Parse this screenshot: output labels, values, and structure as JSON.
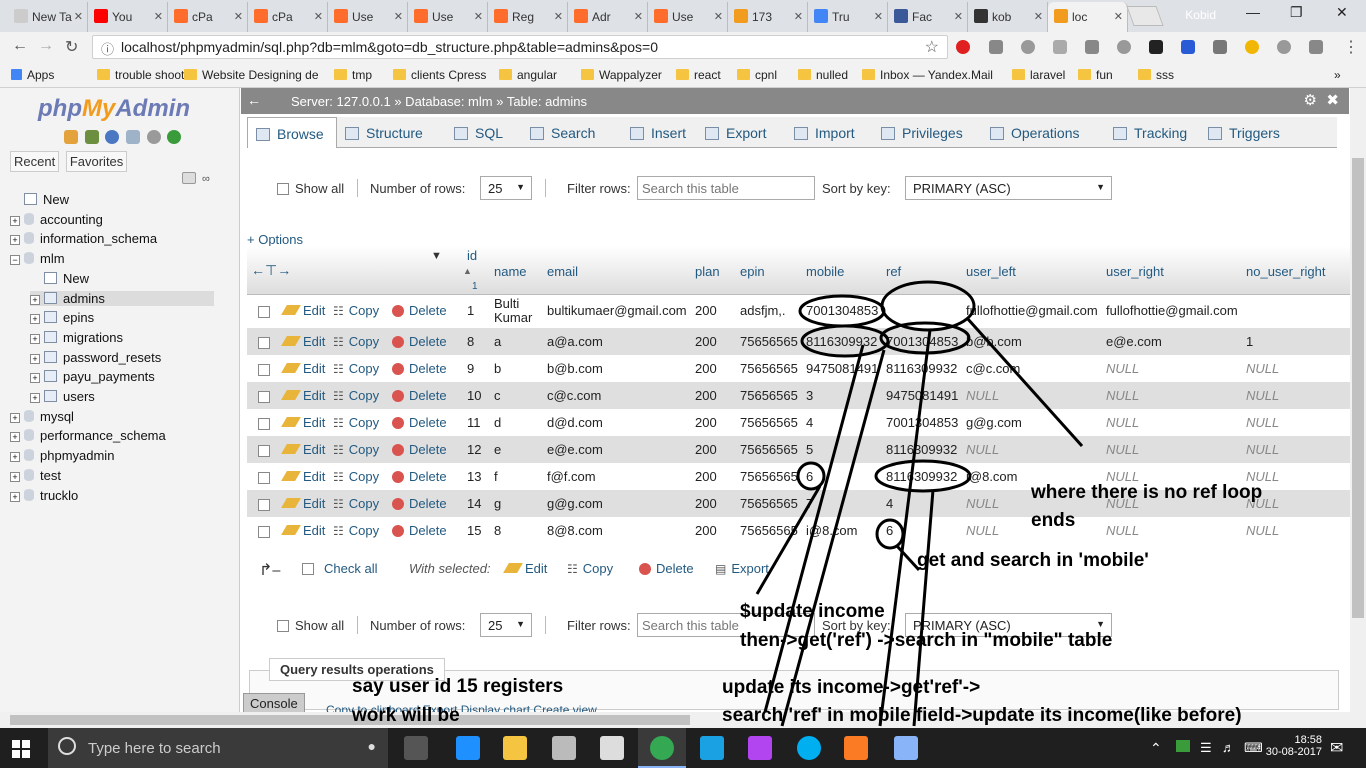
{
  "browser": {
    "tabs": [
      {
        "label": "New Ta",
        "color": "#cccccc"
      },
      {
        "label": "You",
        "color": "#ff0000"
      },
      {
        "label": "cPa",
        "color": "#ff6c2c"
      },
      {
        "label": "cPa",
        "color": "#ff6c2c"
      },
      {
        "label": "Use",
        "color": "#ff6c2c"
      },
      {
        "label": "Use",
        "color": "#ff6c2c"
      },
      {
        "label": "Reg",
        "color": "#ff6c2c"
      },
      {
        "label": "Adr",
        "color": "#ff6c2c"
      },
      {
        "label": "Use",
        "color": "#ff6c2c"
      },
      {
        "label": "173",
        "color": "#f29c1f"
      },
      {
        "label": "Tru",
        "color": "#4285f4"
      },
      {
        "label": "Fac",
        "color": "#3b5998"
      },
      {
        "label": "kob",
        "color": "#333333"
      },
      {
        "label": "loc",
        "color": "#f29c1f"
      }
    ],
    "profile": "Kobid",
    "url": "localhost/phpmyadmin/sql.php?db=mlm&goto=db_structure.php&table=admins&pos=0",
    "bookmarks": [
      "Apps",
      "trouble shoot",
      "Website Designing de",
      "tmp",
      "clients Cpress",
      "angular",
      "Wappalyzer",
      "react",
      "cpnl",
      "nulled",
      "Inbox — Yandex.Mail",
      "laravel",
      "fun",
      "sss"
    ]
  },
  "nav": {
    "logo_php": "php",
    "logo_my": "My",
    "logo_admin": "Admin",
    "tab_recent": "Recent",
    "tab_favorites": "Favorites",
    "tree": [
      {
        "label": "New",
        "kind": "new",
        "indent": 0
      },
      {
        "label": "accounting",
        "kind": "db",
        "indent": 0
      },
      {
        "label": "information_schema",
        "kind": "db",
        "indent": 0
      },
      {
        "label": "mlm",
        "kind": "db-open",
        "indent": 0
      },
      {
        "label": "New",
        "kind": "new",
        "indent": 1
      },
      {
        "label": "admins",
        "kind": "table",
        "indent": 1,
        "selected": true
      },
      {
        "label": "epins",
        "kind": "table",
        "indent": 1
      },
      {
        "label": "migrations",
        "kind": "table",
        "indent": 1
      },
      {
        "label": "password_resets",
        "kind": "table",
        "indent": 1
      },
      {
        "label": "payu_payments",
        "kind": "table",
        "indent": 1
      },
      {
        "label": "users",
        "kind": "table",
        "indent": 1
      },
      {
        "label": "mysql",
        "kind": "db",
        "indent": 0
      },
      {
        "label": "performance_schema",
        "kind": "db",
        "indent": 0
      },
      {
        "label": "phpmyadmin",
        "kind": "db",
        "indent": 0
      },
      {
        "label": "test",
        "kind": "db",
        "indent": 0
      },
      {
        "label": "trucklo",
        "kind": "db",
        "indent": 0
      }
    ]
  },
  "main": {
    "breadcrumb": "Server: 127.0.0.1 » Database: mlm » Table: admins",
    "tabs": [
      "Browse",
      "Structure",
      "SQL",
      "Search",
      "Insert",
      "Export",
      "Import",
      "Privileges",
      "Operations",
      "Tracking",
      "Triggers"
    ],
    "show_all": "Show all",
    "num_rows_label": "Number of rows:",
    "num_rows_value": "25",
    "filter_label": "Filter rows:",
    "filter_placeholder": "Search this table",
    "sort_label": "Sort by key:",
    "sort_value": "PRIMARY (ASC)",
    "options": "+ Options",
    "columns": [
      "id",
      "name",
      "email",
      "plan",
      "epin",
      "mobile",
      "ref",
      "user_left",
      "user_right",
      "no_user_right"
    ],
    "row_actions": {
      "edit": "Edit",
      "copy": "Copy",
      "delete": "Delete"
    },
    "rows": [
      [
        "1",
        "Bulti Kumar",
        "bultikumaer@gmail.com",
        "200",
        "adsfjm,.",
        "7001304853",
        "",
        "fullofhottie@gmail.com",
        "fullofhottie@gmail.com",
        ""
      ],
      [
        "8",
        "a",
        "a@a.com",
        "200",
        "75656565",
        "8116309932",
        "7001304853",
        "b@b.com",
        "e@e.com",
        "1"
      ],
      [
        "9",
        "b",
        "b@b.com",
        "200",
        "75656565",
        "9475081491",
        "8116309932",
        "c@c.com",
        "NULL",
        "NULL"
      ],
      [
        "10",
        "c",
        "c@c.com",
        "200",
        "75656565",
        "3",
        "9475081491",
        "NULL",
        "NULL",
        "NULL"
      ],
      [
        "11",
        "d",
        "d@d.com",
        "200",
        "75656565",
        "4",
        "7001304853",
        "g@g.com",
        "NULL",
        "NULL"
      ],
      [
        "12",
        "e",
        "e@e.com",
        "200",
        "75656565",
        "5",
        "8116309932",
        "NULL",
        "NULL",
        "NULL"
      ],
      [
        "13",
        "f",
        "f@f.com",
        "200",
        "75656565",
        "6",
        "8116309932",
        "i@8.com",
        "NULL",
        "NULL"
      ],
      [
        "14",
        "g",
        "g@g.com",
        "200",
        "75656565",
        "7",
        "4",
        "NULL",
        "NULL",
        "NULL"
      ],
      [
        "15",
        "8",
        "8@8.com",
        "200",
        "75656565",
        "i@8.com",
        "6",
        "NULL",
        "NULL",
        "NULL"
      ]
    ],
    "check_all": "Check all",
    "with_selected": "With selected:",
    "bulk_edit": "Edit",
    "bulk_copy": "Copy",
    "bulk_delete": "Delete",
    "bulk_export": "Export",
    "qro_title": "Query results operations",
    "console": "Console",
    "qro_links": "Copy to clipboard    Export    Display chart    Create view"
  },
  "annotations": {
    "a1": "where there is no ref loop",
    "a2": "ends",
    "a3": "get  and search in 'mobile'",
    "a4": "$update income",
    "a5": "then->get('ref') ->search in \"mobile\" table",
    "a6": "say user id 15 registers",
    "a7": "work will be",
    "a8": "update its income->get'ref'->",
    "a9": "search 'ref' in mobile field->update its income(like before)"
  },
  "taskbar": {
    "search_placeholder": "Type here to search",
    "time": "18:58",
    "date": "30-08-2017",
    "icons": [
      {
        "name": "task-view-icon",
        "color": "#555555"
      },
      {
        "name": "edge-icon",
        "color": "#1e90ff"
      },
      {
        "name": "file-explorer-icon",
        "color": "#f5c542"
      },
      {
        "name": "store-icon",
        "color": "#bbbbbb"
      },
      {
        "name": "mail-icon",
        "color": "#dddddd"
      },
      {
        "name": "chrome-icon",
        "color": "#34a853"
      },
      {
        "name": "webstorm-icon",
        "color": "#1aa1e3"
      },
      {
        "name": "phpstorm-icon",
        "color": "#b345f1"
      },
      {
        "name": "skype-icon",
        "color": "#00aff0"
      },
      {
        "name": "xampp-icon",
        "color": "#fb7a24"
      },
      {
        "name": "paint-icon",
        "color": "#8ab4f8"
      }
    ]
  }
}
